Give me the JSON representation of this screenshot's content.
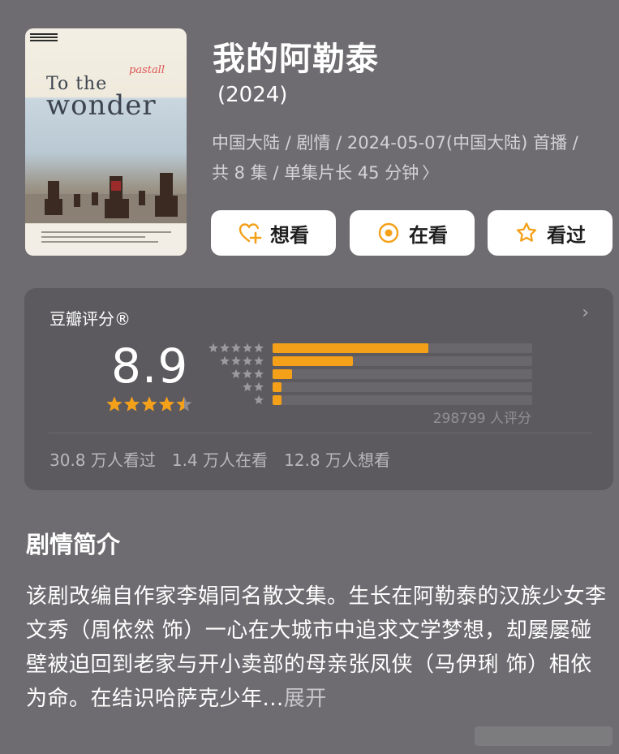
{
  "poster": {
    "title_en_line1": "To the",
    "title_en_line2": "wonder",
    "script_title": "pastall"
  },
  "header": {
    "title": "我的阿勒泰",
    "year": "(2024)",
    "meta_line1": "中国大陆 / 剧情 / 2024-05-07(中国大陆) 首播 /",
    "meta_line2": "共 8 集 / 单集片长 45 分钟",
    "meta_chevron": "chevron-right-icon"
  },
  "actions": [
    {
      "label": "想看",
      "icon": "heart-plus-icon"
    },
    {
      "label": "在看",
      "icon": "target-circle-icon"
    },
    {
      "label": "看过",
      "icon": "star-outline-icon"
    }
  ],
  "rating": {
    "label": "豆瓣评分®",
    "score": "8.9",
    "star_value": 4.5,
    "votes": "298799 人评分",
    "distribution": [
      {
        "stars": 5,
        "fraction": 0.6
      },
      {
        "stars": 4,
        "fraction": 0.31
      },
      {
        "stars": 3,
        "fraction": 0.075
      },
      {
        "stars": 2,
        "fraction": 0.035
      },
      {
        "stars": 1,
        "fraction": 0.035
      }
    ],
    "stats": {
      "watched": "30.8 万人看过",
      "watching": "1.4 万人在看",
      "want": "12.8 万人想看"
    }
  },
  "synopsis": {
    "title": "剧情简介",
    "body": "该剧改编自作家李娟同名散文集。生长在阿勒泰的汉族少女李文秀（周依然 饰）一心在大城市中追求文学梦想，却屡屡碰壁被迫回到老家与开小卖部的母亲张凤侠（马伊琍 饰）相依为命。在结识哈萨克少年...",
    "expand": "展开"
  },
  "colors": {
    "background": "#6e6c70",
    "card": "#5c5a5e",
    "accent": "#f4a018"
  }
}
